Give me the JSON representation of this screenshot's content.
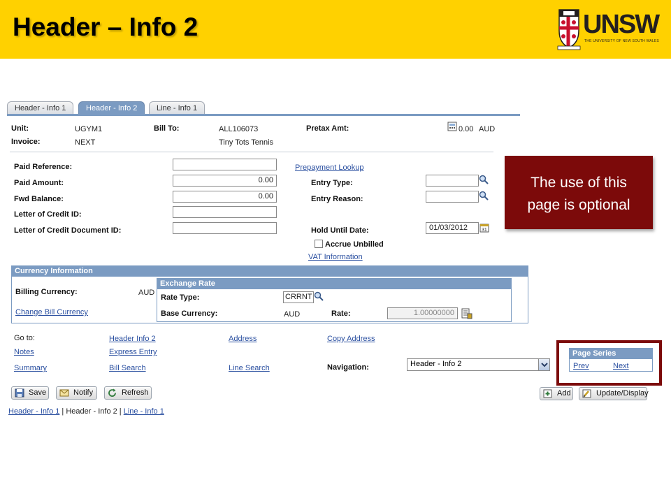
{
  "slide": {
    "title": "Header – Info 2",
    "logo_text": "UNSW",
    "logo_subtext": "THE UNIVERSITY OF NEW SOUTH WALES",
    "colors": {
      "header_bg": "#ffd100",
      "callout_bg": "#7c0a0a",
      "tab_active": "#7b9bc2",
      "link": "#2a4fa0"
    }
  },
  "tabs": [
    {
      "label": "Header - Info 1"
    },
    {
      "label": "Header - Info 2"
    },
    {
      "label": "Line - Info 1"
    }
  ],
  "header": {
    "unit_label": "Unit:",
    "unit_value": "UGYM1",
    "invoice_label": "Invoice:",
    "invoice_value": "NEXT",
    "bill_to_label": "Bill To:",
    "bill_to_value": "ALL106073",
    "bill_to_name": "Tiny Tots Tennis",
    "pretax_label": "Pretax Amt:",
    "pretax_value": "0.00",
    "pretax_currency": "AUD"
  },
  "form": {
    "paid_reference_label": "Paid Reference:",
    "paid_reference_value": "",
    "paid_amount_label": "Paid Amount:",
    "paid_amount_value": "0.00",
    "fwd_balance_label": "Fwd Balance:",
    "fwd_balance_value": "0.00",
    "letter_credit_label": "Letter of Credit ID:",
    "letter_credit_value": "",
    "letter_credit_doc_label": "Letter of Credit Document ID:",
    "letter_credit_doc_value": "",
    "prepayment_lookup": "Prepayment Lookup",
    "entry_type_label": "Entry Type:",
    "entry_type_value": "",
    "entry_reason_label": "Entry Reason:",
    "entry_reason_value": "",
    "hold_until_label": "Hold Until Date:",
    "hold_until_value": "01/03/2012",
    "accrue_unbilled_label": "Accrue Unbilled",
    "vat_information": "VAT Information"
  },
  "currency": {
    "title": "Currency Information",
    "billing_currency_label": "Billing Currency:",
    "billing_currency_value": "AUD",
    "change_bill_currency": "Change Bill Currency",
    "exchange_rate_title": "Exchange Rate",
    "rate_type_label": "Rate Type:",
    "rate_type_value": "CRRNT",
    "base_currency_label": "Base Currency:",
    "base_currency_value": "AUD",
    "rate_label": "Rate:",
    "rate_value": "1.00000000"
  },
  "goto": {
    "label": "Go to:",
    "links": {
      "header_info2": "Header Info 2",
      "address": "Address",
      "copy_address": "Copy Address",
      "notes": "Notes",
      "express_entry": "Express Entry",
      "summary": "Summary",
      "bill_search": "Bill Search",
      "line_search": "Line Search"
    },
    "navigation_label": "Navigation:",
    "navigation_value": "Header - Info 2"
  },
  "page_series": {
    "title": "Page Series",
    "prev": "Prev",
    "next": "Next"
  },
  "buttons": {
    "save": "Save",
    "notify": "Notify",
    "refresh": "Refresh",
    "add": "Add",
    "update_display": "Update/Display"
  },
  "bottom_links": {
    "header_info1": "Header - Info 1",
    "sep1": " | ",
    "header_info2": "Header - Info 2",
    "sep2": " | ",
    "line_info1": "Line - Info 1"
  },
  "callout": {
    "line1": "The use of this",
    "line2": "page is optional"
  }
}
